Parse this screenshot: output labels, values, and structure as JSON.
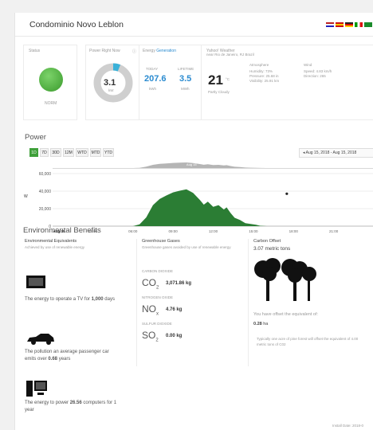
{
  "header": {
    "title": "Condominio Novo Leblon"
  },
  "status": {
    "label": "Status",
    "value": "NORM",
    "color": "#52b03c"
  },
  "power_now": {
    "label": "Power Right Now",
    "value": "3.1",
    "unit": "kW",
    "fraction": 0.06
  },
  "energy": {
    "label": "Energy",
    "label_link": "Generation",
    "today_label": "TODAY",
    "today_value": "207.6",
    "today_unit": "kWh",
    "lifetime_label": "LIFETIME",
    "lifetime_value": "3.5",
    "lifetime_unit": "MWh"
  },
  "weather": {
    "label": "Yahoo! Weather",
    "location": "near Rio de Janeiro, RJ Brazil",
    "temp": "21",
    "unit": "°C",
    "condition": "Partly Cloudy",
    "atm_label": "Atmosphere",
    "humidity": "Humidity: 73%",
    "pressure": "Pressure: 25.68 in",
    "visibility": "Visibility: 25.91 km",
    "wind_label": "Wind",
    "speed": "Speed: 4.83 km/h",
    "direction": "Direction: 265"
  },
  "power": {
    "title": "Power",
    "buttons": [
      "1D",
      "7D",
      "30D",
      "12M",
      "WTD",
      "MTD",
      "YTD"
    ],
    "active": "1D",
    "date_range": "Aug 15, 2018 - Aug 15, 2018"
  },
  "chart_data": {
    "type": "area",
    "ylabel": "W",
    "y_ticks": [
      "60,000",
      "40,000",
      "20,000",
      "0"
    ],
    "x_ticks": [
      "Aug 15",
      "03:00",
      "06:00",
      "09:00",
      "12:00",
      "15:00",
      "18:00",
      "21:00"
    ],
    "ylim": [
      0,
      60000
    ],
    "color": "#2b7d34",
    "x": [
      6.0,
      6.5,
      7.0,
      7.5,
      8.0,
      8.5,
      9.0,
      9.5,
      10.0,
      10.5,
      11.0,
      11.3,
      11.6,
      12.0,
      12.4,
      12.8,
      13.0,
      13.3,
      13.6,
      14.0,
      14.4,
      14.8,
      15.2,
      15.5,
      16.0
    ],
    "values": [
      0,
      2000,
      10000,
      24000,
      31000,
      35000,
      38500,
      40500,
      42000,
      38000,
      30000,
      24500,
      28000,
      22000,
      24000,
      19000,
      21500,
      15000,
      9500,
      7000,
      3500,
      2500,
      1500,
      500,
      0
    ],
    "point": {
      "x": 17.5,
      "y": 37000
    },
    "navigator_label": "Aug 15"
  },
  "env": {
    "title": "Environmental Benefits",
    "eq_title": "Environmental Equivalents",
    "eq_sub": "Achieved by use of renewable energy",
    "tv_text": "The energy to operate a TV for ",
    "tv_value": "1,000",
    "tv_unit": " days",
    "car_text": "The pollution an average passenger car emits over ",
    "car_value": "0.68",
    "car_unit": " years",
    "pc_text": "The energy to power ",
    "pc_value": "26.56",
    "pc_unit": " computers for 1 year",
    "gas_title": "Greenhouse Gases",
    "gas_sub": "Greenhouse gases avoided by use of renewable energy",
    "co2_label": "CARBON DIOXIDE",
    "co2": "CO",
    "co2_sub": "2",
    "co2_value": "3,071.86 kg",
    "no2_label": "NITROGEN OXIDE",
    "no2": "NO",
    "no2_sub": "x",
    "no2_value": "4.76 kg",
    "so2_label": "SULFUR DIOXIDE",
    "so2": "SO",
    "so2_sub": "2",
    "so2_value": "0.00 kg",
    "offset_title": "Carbon Offset",
    "offset_value": "3.07 metric tons",
    "offset_text": "You have offset the equivalent of:",
    "offset_area": "0.28",
    "offset_area_unit": " ha",
    "offset_note": "Typically one acre of pine forest will offset the equivalent of 4.00 metric tons of C02"
  },
  "footer": "Install Date: 2018-0"
}
